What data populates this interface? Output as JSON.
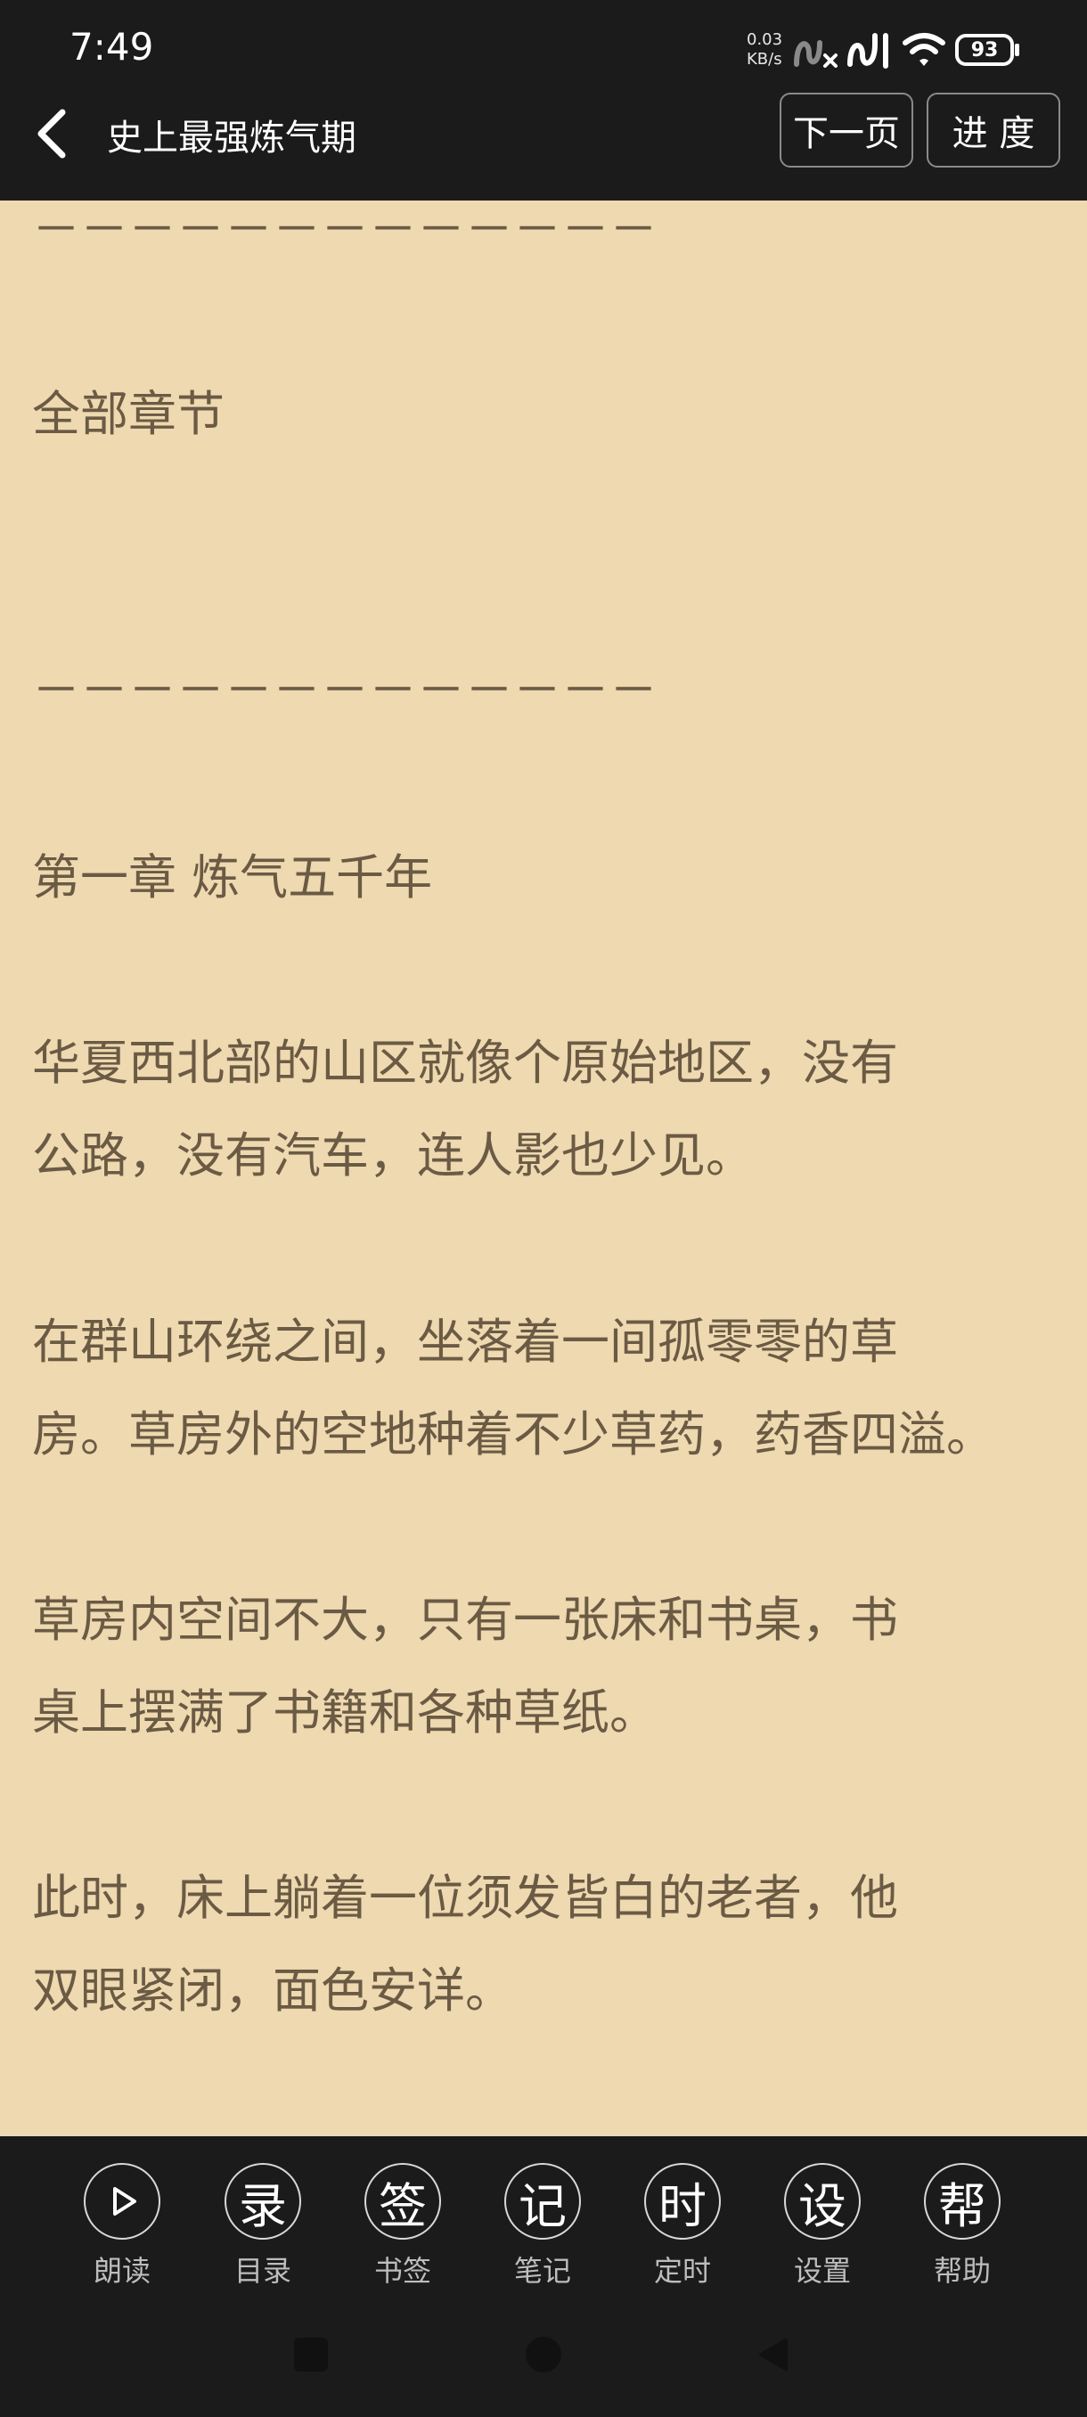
{
  "status": {
    "time": "7:49",
    "net_speed_value": "0.03",
    "net_speed_unit": "KB/s",
    "battery": "93"
  },
  "header": {
    "title": "史上最强炼气期",
    "next_page_label": "下一页",
    "progress_label": "进 度"
  },
  "content": {
    "lines": [
      "－－－－－－－－－－－－－",
      "全部章节",
      "－－－－－－－－－－－－－",
      "第一章 炼气五千年",
      "华夏西北部的山区就像个原始地区，没有",
      "公路，没有汽车，连人影也少见。",
      "在群山环绕之间，坐落着一间孤零零的草",
      "房。草房外的空地种着不少草药，药香四溢。",
      "草房内空间不大，只有一张床和书桌，书",
      "桌上摆满了书籍和各种草纸。",
      "此时，床上躺着一位须发皆白的老者，他",
      "双眼紧闭，面色安详。"
    ]
  },
  "menu": {
    "items": [
      {
        "glyph": "",
        "label": "朗读"
      },
      {
        "glyph": "录",
        "label": "目录"
      },
      {
        "glyph": "签",
        "label": "书签"
      },
      {
        "glyph": "记",
        "label": "笔记"
      },
      {
        "glyph": "时",
        "label": "定时"
      },
      {
        "glyph": "设",
        "label": "设置"
      },
      {
        "glyph": "帮",
        "label": "帮助"
      }
    ]
  },
  "colors": {
    "page_background": "#eed9b0",
    "text": "#6b5a44",
    "chrome": "#1b1b1b"
  }
}
